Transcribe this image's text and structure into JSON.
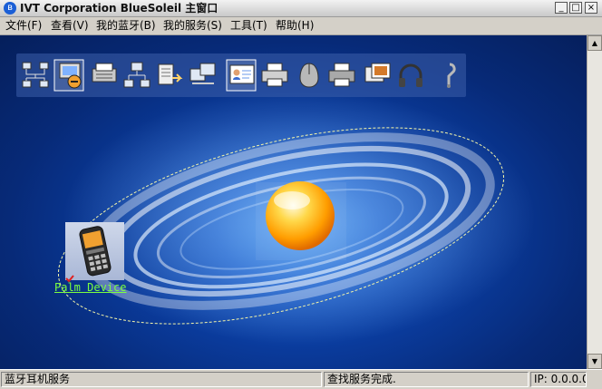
{
  "window": {
    "title": "IVT Corporation BlueSoleil 主窗口",
    "icon": "bluetooth-icon",
    "minimize": "_",
    "maximize": "□",
    "close": "×"
  },
  "menu": [
    {
      "label": "文件(F)"
    },
    {
      "label": "查看(V)"
    },
    {
      "label": "我的蓝牙(B)"
    },
    {
      "label": "我的服务(S)"
    },
    {
      "label": "工具(T)"
    },
    {
      "label": "帮助(H)"
    }
  ],
  "toolbar": {
    "icons": [
      "network-icon",
      "dialup-icon",
      "fax-icon",
      "lan-icon",
      "file-transfer-icon",
      "pim-sync-icon",
      "business-card-icon",
      "printer-icon",
      "hid-icon",
      "printer-icon",
      "image-icon",
      "headphones-icon",
      "headset-icon"
    ],
    "active_index": [
      1,
      6
    ]
  },
  "device": {
    "label": "Palm Device",
    "icon": "mobile-phone-icon"
  },
  "center": {
    "icon": "local-device-orb-icon"
  },
  "status": {
    "left": "蓝牙耳机服务",
    "middle": "查找服务完成.",
    "ip": "IP: 0.0.0.0"
  },
  "scrollbar": {
    "up": "▲",
    "down": "▼"
  },
  "colors": {
    "background": "#0a3b9c",
    "link": "#7cff40",
    "orb": "#ffb000"
  }
}
